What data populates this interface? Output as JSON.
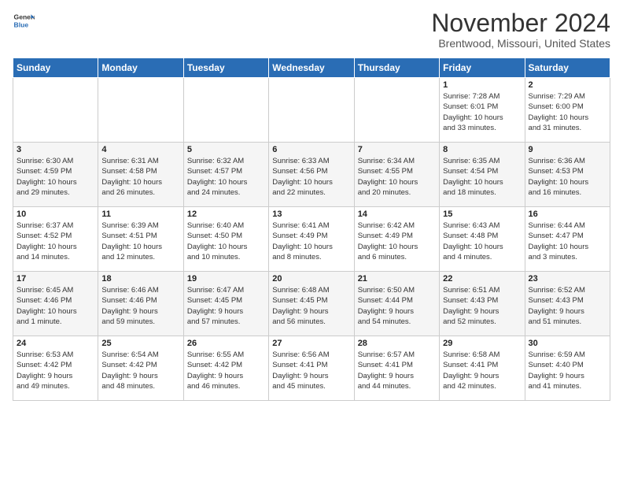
{
  "header": {
    "logo": {
      "line1": "General",
      "line2": "Blue"
    },
    "title": "November 2024",
    "location": "Brentwood, Missouri, United States"
  },
  "days_of_week": [
    "Sunday",
    "Monday",
    "Tuesday",
    "Wednesday",
    "Thursday",
    "Friday",
    "Saturday"
  ],
  "weeks": [
    [
      {
        "day": "",
        "info": ""
      },
      {
        "day": "",
        "info": ""
      },
      {
        "day": "",
        "info": ""
      },
      {
        "day": "",
        "info": ""
      },
      {
        "day": "",
        "info": ""
      },
      {
        "day": "1",
        "info": "Sunrise: 7:28 AM\nSunset: 6:01 PM\nDaylight: 10 hours\nand 33 minutes."
      },
      {
        "day": "2",
        "info": "Sunrise: 7:29 AM\nSunset: 6:00 PM\nDaylight: 10 hours\nand 31 minutes."
      }
    ],
    [
      {
        "day": "3",
        "info": "Sunrise: 6:30 AM\nSunset: 4:59 PM\nDaylight: 10 hours\nand 29 minutes."
      },
      {
        "day": "4",
        "info": "Sunrise: 6:31 AM\nSunset: 4:58 PM\nDaylight: 10 hours\nand 26 minutes."
      },
      {
        "day": "5",
        "info": "Sunrise: 6:32 AM\nSunset: 4:57 PM\nDaylight: 10 hours\nand 24 minutes."
      },
      {
        "day": "6",
        "info": "Sunrise: 6:33 AM\nSunset: 4:56 PM\nDaylight: 10 hours\nand 22 minutes."
      },
      {
        "day": "7",
        "info": "Sunrise: 6:34 AM\nSunset: 4:55 PM\nDaylight: 10 hours\nand 20 minutes."
      },
      {
        "day": "8",
        "info": "Sunrise: 6:35 AM\nSunset: 4:54 PM\nDaylight: 10 hours\nand 18 minutes."
      },
      {
        "day": "9",
        "info": "Sunrise: 6:36 AM\nSunset: 4:53 PM\nDaylight: 10 hours\nand 16 minutes."
      }
    ],
    [
      {
        "day": "10",
        "info": "Sunrise: 6:37 AM\nSunset: 4:52 PM\nDaylight: 10 hours\nand 14 minutes."
      },
      {
        "day": "11",
        "info": "Sunrise: 6:39 AM\nSunset: 4:51 PM\nDaylight: 10 hours\nand 12 minutes."
      },
      {
        "day": "12",
        "info": "Sunrise: 6:40 AM\nSunset: 4:50 PM\nDaylight: 10 hours\nand 10 minutes."
      },
      {
        "day": "13",
        "info": "Sunrise: 6:41 AM\nSunset: 4:49 PM\nDaylight: 10 hours\nand 8 minutes."
      },
      {
        "day": "14",
        "info": "Sunrise: 6:42 AM\nSunset: 4:49 PM\nDaylight: 10 hours\nand 6 minutes."
      },
      {
        "day": "15",
        "info": "Sunrise: 6:43 AM\nSunset: 4:48 PM\nDaylight: 10 hours\nand 4 minutes."
      },
      {
        "day": "16",
        "info": "Sunrise: 6:44 AM\nSunset: 4:47 PM\nDaylight: 10 hours\nand 3 minutes."
      }
    ],
    [
      {
        "day": "17",
        "info": "Sunrise: 6:45 AM\nSunset: 4:46 PM\nDaylight: 10 hours\nand 1 minute."
      },
      {
        "day": "18",
        "info": "Sunrise: 6:46 AM\nSunset: 4:46 PM\nDaylight: 9 hours\nand 59 minutes."
      },
      {
        "day": "19",
        "info": "Sunrise: 6:47 AM\nSunset: 4:45 PM\nDaylight: 9 hours\nand 57 minutes."
      },
      {
        "day": "20",
        "info": "Sunrise: 6:48 AM\nSunset: 4:45 PM\nDaylight: 9 hours\nand 56 minutes."
      },
      {
        "day": "21",
        "info": "Sunrise: 6:50 AM\nSunset: 4:44 PM\nDaylight: 9 hours\nand 54 minutes."
      },
      {
        "day": "22",
        "info": "Sunrise: 6:51 AM\nSunset: 4:43 PM\nDaylight: 9 hours\nand 52 minutes."
      },
      {
        "day": "23",
        "info": "Sunrise: 6:52 AM\nSunset: 4:43 PM\nDaylight: 9 hours\nand 51 minutes."
      }
    ],
    [
      {
        "day": "24",
        "info": "Sunrise: 6:53 AM\nSunset: 4:42 PM\nDaylight: 9 hours\nand 49 minutes."
      },
      {
        "day": "25",
        "info": "Sunrise: 6:54 AM\nSunset: 4:42 PM\nDaylight: 9 hours\nand 48 minutes."
      },
      {
        "day": "26",
        "info": "Sunrise: 6:55 AM\nSunset: 4:42 PM\nDaylight: 9 hours\nand 46 minutes."
      },
      {
        "day": "27",
        "info": "Sunrise: 6:56 AM\nSunset: 4:41 PM\nDaylight: 9 hours\nand 45 minutes."
      },
      {
        "day": "28",
        "info": "Sunrise: 6:57 AM\nSunset: 4:41 PM\nDaylight: 9 hours\nand 44 minutes."
      },
      {
        "day": "29",
        "info": "Sunrise: 6:58 AM\nSunset: 4:41 PM\nDaylight: 9 hours\nand 42 minutes."
      },
      {
        "day": "30",
        "info": "Sunrise: 6:59 AM\nSunset: 4:40 PM\nDaylight: 9 hours\nand 41 minutes."
      }
    ]
  ]
}
